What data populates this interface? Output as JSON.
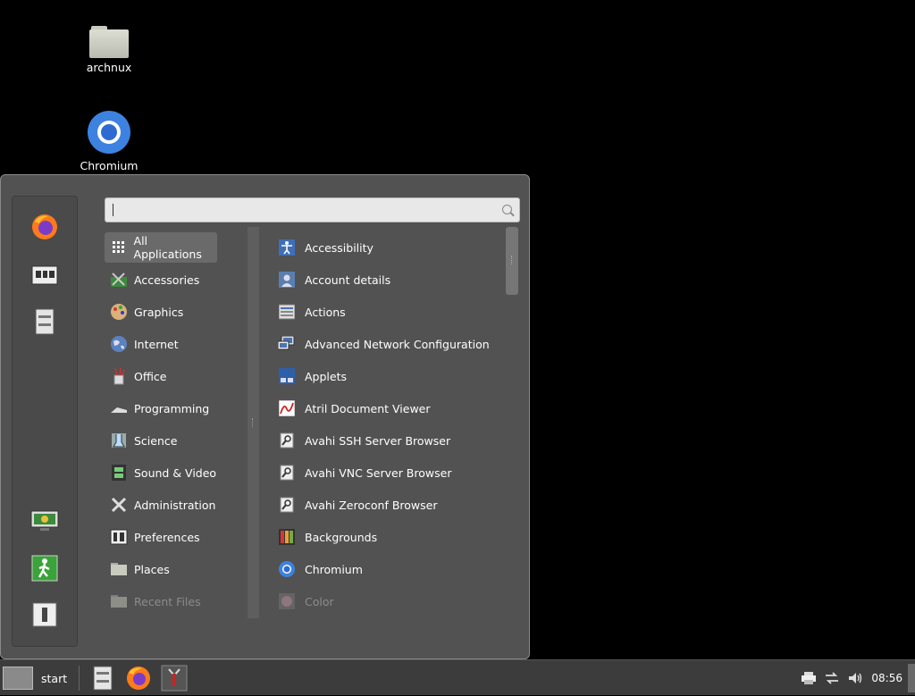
{
  "desktop": {
    "icons": [
      {
        "label": "archnux"
      },
      {
        "label": "Chromium"
      }
    ]
  },
  "search": {
    "placeholder": ""
  },
  "categories": [
    {
      "label": "All Applications",
      "icon": "grid-icon",
      "selected": true
    },
    {
      "label": "Accessories",
      "icon": "accessories-icon"
    },
    {
      "label": "Graphics",
      "icon": "graphics-icon"
    },
    {
      "label": "Internet",
      "icon": "globe-icon"
    },
    {
      "label": "Office",
      "icon": "office-icon"
    },
    {
      "label": "Programming",
      "icon": "programming-icon"
    },
    {
      "label": "Science",
      "icon": "science-icon"
    },
    {
      "label": "Sound & Video",
      "icon": "film-icon"
    },
    {
      "label": "Administration",
      "icon": "tools-icon"
    },
    {
      "label": "Preferences",
      "icon": "preferences-icon"
    },
    {
      "label": "Places",
      "icon": "folder-icon"
    },
    {
      "label": "Recent Files",
      "icon": "recent-files-icon"
    }
  ],
  "apps": [
    {
      "label": "Accessibility",
      "icon": "accessibility-icon"
    },
    {
      "label": "Account details",
      "icon": "account-icon"
    },
    {
      "label": "Actions",
      "icon": "actions-icon"
    },
    {
      "label": "Advanced Network Configuration",
      "icon": "network-icon"
    },
    {
      "label": "Applets",
      "icon": "applets-icon"
    },
    {
      "label": "Atril Document Viewer",
      "icon": "document-viewer-icon"
    },
    {
      "label": "Avahi SSH Server Browser",
      "icon": "avahi-icon"
    },
    {
      "label": "Avahi VNC Server Browser",
      "icon": "avahi-icon"
    },
    {
      "label": "Avahi Zeroconf Browser",
      "icon": "avahi-icon"
    },
    {
      "label": "Backgrounds",
      "icon": "backgrounds-icon"
    },
    {
      "label": "Chromium",
      "icon": "chromium-icon"
    },
    {
      "label": "Color",
      "icon": "color-icon"
    }
  ],
  "favorites": [
    "firefox-icon",
    "system-settings-icon",
    "file-manager-icon"
  ],
  "session_buttons": [
    "lock-screen-icon",
    "logout-icon",
    "shutdown-icon"
  ],
  "taskbar": {
    "start_label": "start",
    "clock": "08:56"
  },
  "colors": {
    "menu_bg": "#525252",
    "panel_bg": "#3c3c3c",
    "selected_bg": "#6a6a6a",
    "accent_green": "#3aa33a"
  }
}
